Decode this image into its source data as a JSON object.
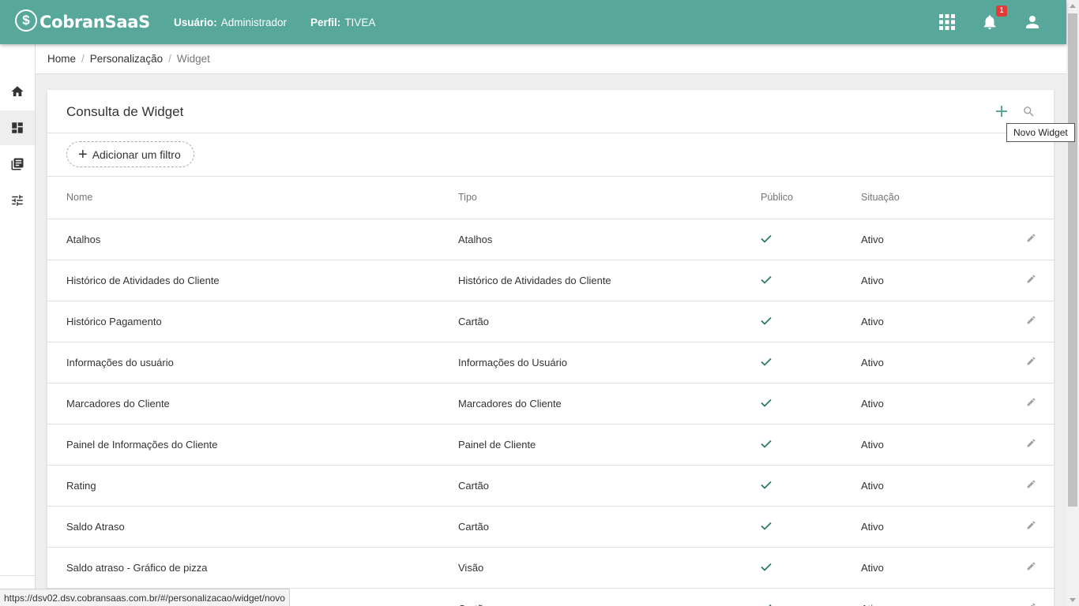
{
  "header": {
    "logo_text": "CobranSaaS",
    "logo_mark": "$",
    "user_label": "Usuário:",
    "user_value": "Administrador",
    "profile_label": "Perfil:",
    "profile_value": "TIVEA",
    "notification_count": "1",
    "icons": [
      "apps-icon",
      "bell-icon",
      "user-icon"
    ]
  },
  "sidebar": {
    "items": [
      {
        "icon": "home-icon"
      },
      {
        "icon": "dashboard-icon",
        "active": true
      },
      {
        "icon": "library-icon"
      },
      {
        "icon": "tune-icon"
      }
    ]
  },
  "breadcrumb": {
    "home": "Home",
    "section": "Personalização",
    "current": "Widget",
    "separator": "/"
  },
  "card": {
    "title": "Consulta de Widget",
    "tooltip": "Novo Widget",
    "filter_label": "Adicionar um filtro",
    "filter_plus": "+"
  },
  "table": {
    "columns": [
      "Nome",
      "Tipo",
      "Público",
      "Situação"
    ],
    "rows": [
      {
        "nome": "Atalhos",
        "tipo": "Atalhos",
        "publico": true,
        "situacao": "Ativo"
      },
      {
        "nome": "Histórico de Atividades do Cliente",
        "tipo": "Histórico de Atividades do Cliente",
        "publico": true,
        "situacao": "Ativo"
      },
      {
        "nome": "Histórico Pagamento",
        "tipo": "Cartão",
        "publico": true,
        "situacao": "Ativo"
      },
      {
        "nome": "Informações do usuário",
        "tipo": "Informações do Usuário",
        "publico": true,
        "situacao": "Ativo"
      },
      {
        "nome": "Marcadores do Cliente",
        "tipo": "Marcadores do Cliente",
        "publico": true,
        "situacao": "Ativo"
      },
      {
        "nome": "Painel de Informações do Cliente",
        "tipo": "Painel de Cliente",
        "publico": true,
        "situacao": "Ativo"
      },
      {
        "nome": "Rating",
        "tipo": "Cartão",
        "publico": true,
        "situacao": "Ativo"
      },
      {
        "nome": "Saldo Atraso",
        "tipo": "Cartão",
        "publico": true,
        "situacao": "Ativo"
      },
      {
        "nome": "Saldo atraso - Gráfico de pizza",
        "tipo": "Visão",
        "publico": true,
        "situacao": "Ativo"
      },
      {
        "nome": "",
        "tipo": "Cartão",
        "publico": true,
        "situacao": "Ativo"
      }
    ]
  },
  "status_url": "https://dsv02.dsv.cobransaas.com.br/#/personalizacao/widget/novo",
  "colors": {
    "topbar": "#57a89a",
    "accent": "#2e7d5b",
    "badge": "#e53935"
  }
}
